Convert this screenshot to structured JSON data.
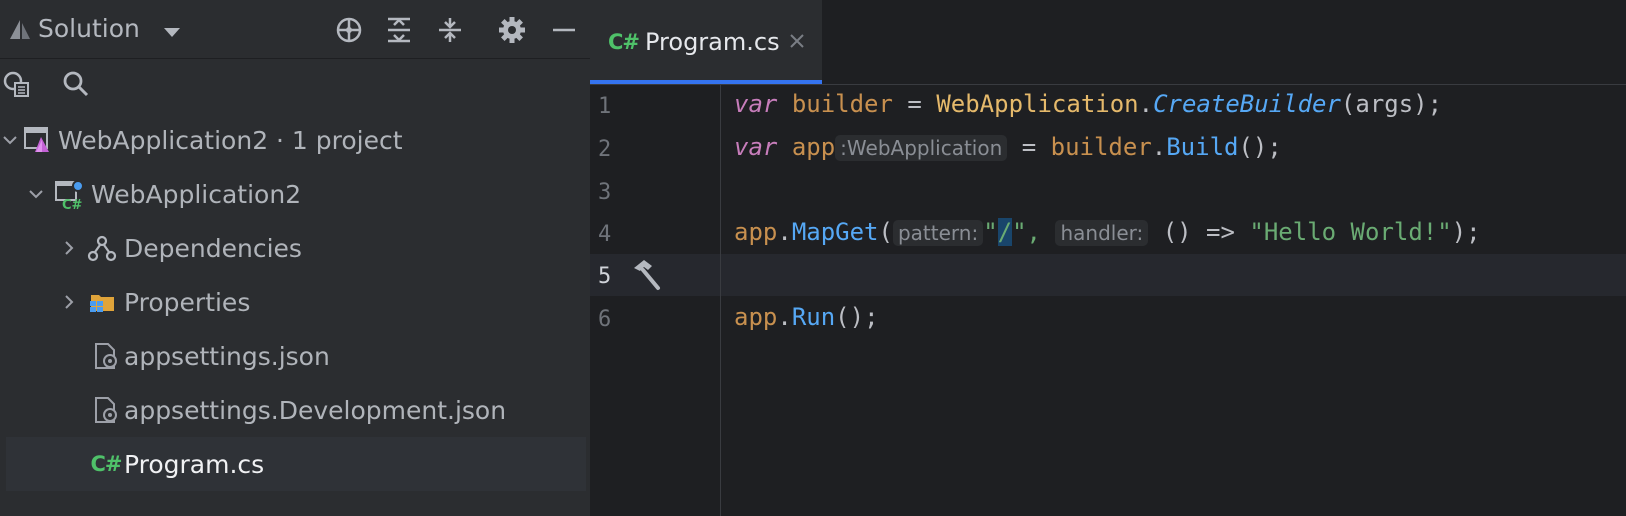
{
  "sidebar": {
    "title": "Solution",
    "toolbar_icons": [
      "locate-icon",
      "expand-all-icon",
      "collapse-all-icon",
      "gear-icon",
      "minimize-icon"
    ],
    "tree": [
      {
        "label": "WebApplication2 · 1 project",
        "icon": "solution-icon",
        "depth": 0,
        "chevron": "down"
      },
      {
        "label": "WebApplication2",
        "icon": "csharp-project-icon",
        "depth": 1,
        "chevron": "down"
      },
      {
        "label": "Dependencies",
        "icon": "dependencies-icon",
        "depth": 2,
        "chevron": "right"
      },
      {
        "label": "Properties",
        "icon": "properties-folder-icon",
        "depth": 2,
        "chevron": "right"
      },
      {
        "label": "appsettings.json",
        "icon": "json-settings-icon",
        "depth": 2,
        "chevron": ""
      },
      {
        "label": "appsettings.Development.json",
        "icon": "json-settings-icon",
        "depth": 2,
        "chevron": ""
      },
      {
        "label": "Program.cs",
        "icon": "csharp-file-icon",
        "depth": 2,
        "chevron": "",
        "selected": true
      }
    ],
    "cs_badge": "C#"
  },
  "editor": {
    "tab": {
      "label": "Program.cs",
      "badge": "C#"
    },
    "line_numbers": [
      "1",
      "2",
      "3",
      "4",
      "5",
      "6"
    ],
    "current_line": "5",
    "code": {
      "l1": {
        "kw": "var",
        "v": "builder",
        "eq": " = ",
        "cls": "WebApplication",
        "dot": ".",
        "mth": "CreateBuilder",
        "rest": "(args);"
      },
      "l2": {
        "kw": "var",
        "v": "app",
        "hint": ":WebApplication",
        "eq": " = ",
        "v2": "builder",
        "dot": ".",
        "mth": "Build",
        "rest": "();"
      },
      "l4": {
        "v": "app",
        "dot": ".",
        "mth": "MapGet",
        "p1": "(",
        "hint1": "pattern:",
        "q1": "\"",
        "slash": "/",
        "q2": "\",",
        "hint2": "handler:",
        "lam": "() => ",
        "str": "\"Hello World!\"",
        "end": ");"
      },
      "l6": {
        "v": "app",
        "dot": ".",
        "mth": "Run",
        "rest": "();"
      }
    }
  },
  "colors": {
    "accent": "#3574f0",
    "keyword": "#c77dbb",
    "string": "#6aab73",
    "method": "#56a8f5",
    "class": "#e5b96b",
    "variable": "#c8904f"
  }
}
